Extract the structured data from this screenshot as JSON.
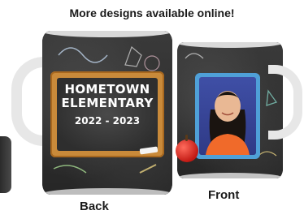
{
  "headline": "More designs available online!",
  "back_mug": {
    "caption": "Back",
    "board_title_line1": "HOMETOWN",
    "board_title_line2": "ELEMENTARY",
    "board_year": "2022 - 2023"
  },
  "front_mug": {
    "caption": "Front"
  },
  "colors": {
    "chalkboard": "#2e2e2e",
    "frame_wood": "#c98a3a",
    "photo_border": "#4fa0d8",
    "apple": "#c21a14"
  }
}
